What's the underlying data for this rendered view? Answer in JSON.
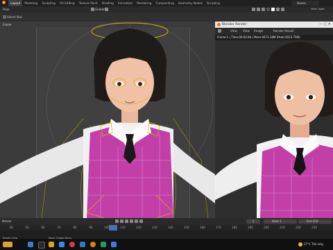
{
  "topbar": {
    "tabs": [
      "Layout",
      "Modeling",
      "Sculpting",
      "UV Editing",
      "Texture Paint",
      "Shading",
      "Animation",
      "Rendering",
      "Compositing",
      "Geometry Nodes",
      "Scripting"
    ],
    "scene_label": "Scene"
  },
  "header": {
    "mode": "Pose",
    "select_box": "Select Box",
    "orientation": "Global",
    "view_layer_label": "View Layer"
  },
  "viewport": {
    "frame_label": "Frame"
  },
  "render_window": {
    "title": "Blender Render",
    "menu": [
      "View",
      "View",
      "Image"
    ],
    "slot": "Render Result",
    "info": "Frame:1 | Time:00:02.84 | Mem:4073.18M (Peak:5023.75M)"
  },
  "timeline": {
    "label": "Marker",
    "ruler": [
      "40",
      "50",
      "60",
      "70",
      "80",
      "90",
      "100",
      "110",
      "120",
      "130",
      "140",
      "150",
      "160",
      "170",
      "180",
      "190",
      "200",
      "210",
      "220",
      "230"
    ],
    "current_frame": "1",
    "start_label": "Start",
    "start": "1",
    "end_label": "End",
    "end": "250"
  },
  "statusbar": {
    "left_text": "Rotate View",
    "middle_text": "Move Global Menu",
    "weather": "27°C  Trời mây",
    "language": "ENG"
  },
  "colors": {
    "accent": "#4772b3",
    "vest": "#c23fa8",
    "rig": "#d4b400"
  }
}
